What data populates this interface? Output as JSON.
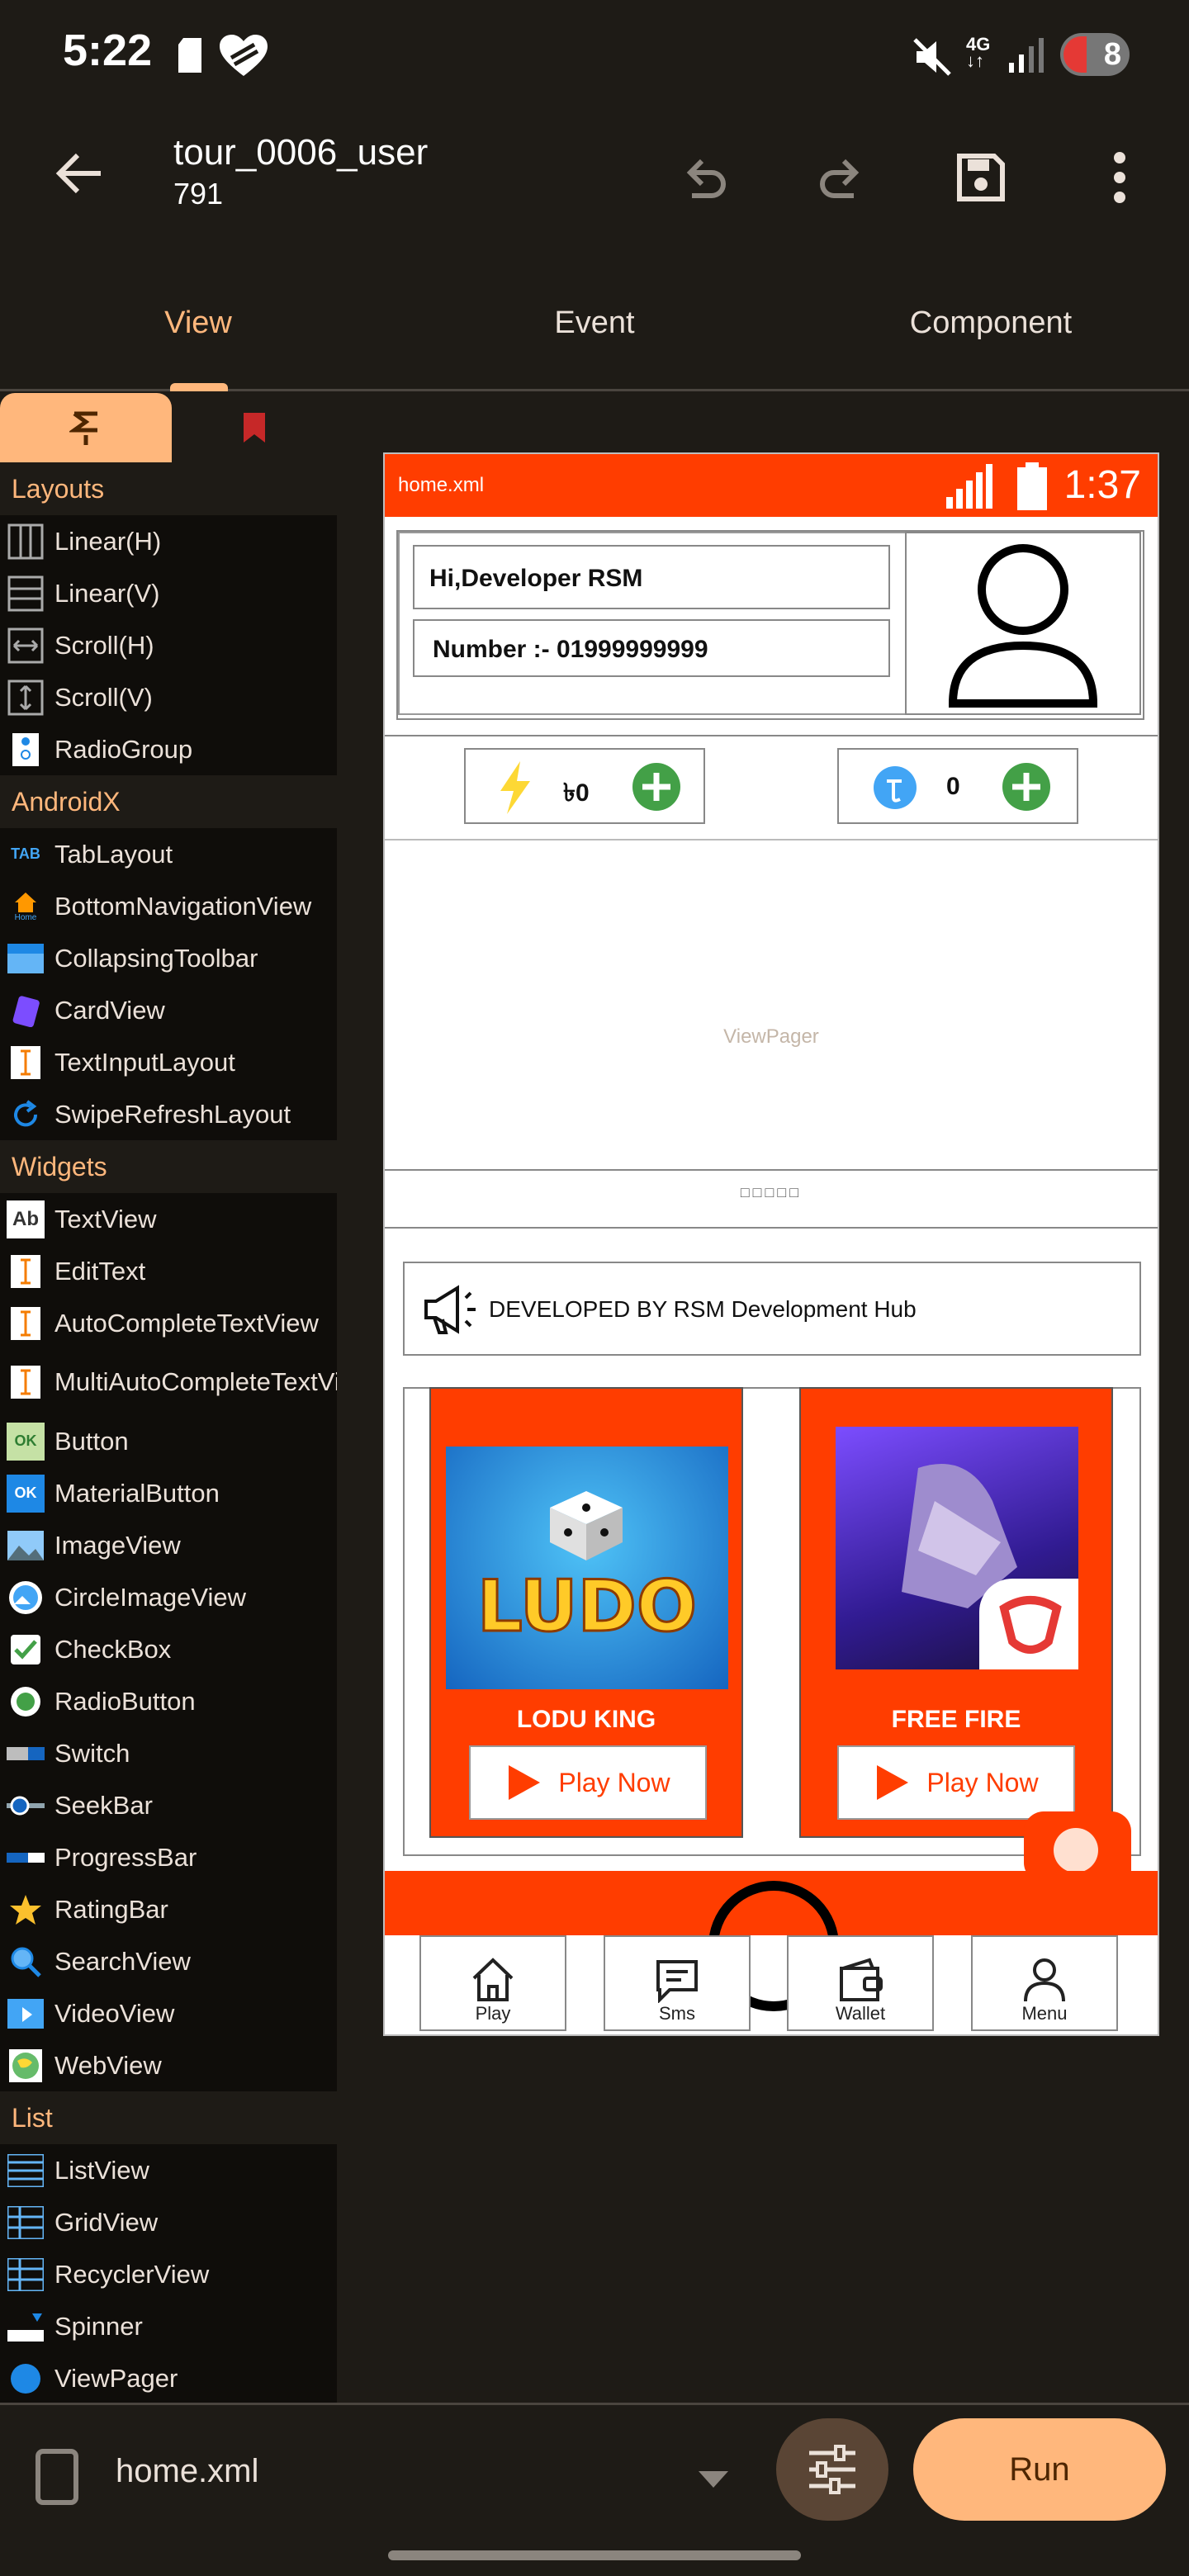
{
  "status_bar": {
    "time": "5:22",
    "network": "4G",
    "battery": "8"
  },
  "app_bar": {
    "title": "tour_0006_user",
    "subtitle": "791"
  },
  "tabs": [
    {
      "label": "View",
      "active": true
    },
    {
      "label": "Event",
      "active": false
    },
    {
      "label": "Component",
      "active": false
    }
  ],
  "palette": {
    "sections": [
      {
        "title": "Layouts",
        "items": [
          "Linear(H)",
          "Linear(V)",
          "Scroll(H)",
          "Scroll(V)",
          "RadioGroup"
        ]
      },
      {
        "title": "AndroidX",
        "items": [
          "TabLayout",
          "BottomNavigationView",
          "CollapsingToolbar",
          "CardView",
          "TextInputLayout",
          "SwipeRefreshLayout"
        ]
      },
      {
        "title": "Widgets",
        "items": [
          "TextView",
          "EditText",
          "AutoCompleteTextView",
          "MultiAutoCompleteTextView",
          "Button",
          "MaterialButton",
          "ImageView",
          "CircleImageView",
          "CheckBox",
          "RadioButton",
          "Switch",
          "SeekBar",
          "ProgressBar",
          "RatingBar",
          "SearchView",
          "VideoView",
          "WebView"
        ]
      },
      {
        "title": "List",
        "items": [
          "ListView",
          "GridView",
          "RecyclerView",
          "Spinner",
          "ViewPager"
        ]
      }
    ],
    "icon_labels": {
      "tab": "TAB",
      "ab": "Ab",
      "ok": "OK",
      "home": "Home"
    }
  },
  "preview": {
    "status_name": "home.xml",
    "status_time": "1:37",
    "greeting": "Hi,Developer RSM",
    "number": "Number :- 01999999999",
    "balance_1": "৳0",
    "balance_2": "0",
    "viewpager_label": "ViewPager",
    "indicator_dots": "□□□□□",
    "notice": "DEVELOPED BY RSM Development Hub",
    "games": [
      {
        "name": "LODU KING",
        "button": "Play Now",
        "logo_text": "LUDO"
      },
      {
        "name": "FREE FIRE",
        "button": "Play Now"
      }
    ],
    "bottom_nav": [
      "Play",
      "Sms",
      "Wallet",
      "Menu"
    ],
    "accent_color": "#ff3d00"
  },
  "bottom_bar": {
    "file": "home.xml",
    "run_label": "Run"
  }
}
